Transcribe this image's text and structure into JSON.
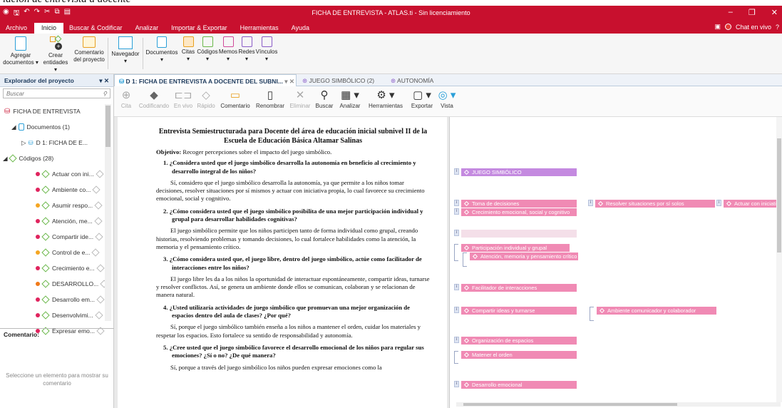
{
  "caption": "lación de entrevista a docente",
  "window": {
    "title": "FICHA DE ENTREVISTA - ATLAS.ti - Sin licenciamiento",
    "controls": [
      "–",
      "❐",
      "✕"
    ]
  },
  "menu": {
    "items": [
      "Archivo",
      "Inicio",
      "Buscar & Codificar",
      "Analizar",
      "Importar & Exportar",
      "Herramientas",
      "Ayuda"
    ],
    "active": "Inicio",
    "chat": "Chat en vivo",
    "help": "?"
  },
  "ribbon": {
    "agregar": [
      "Agregar",
      "documentos ▾"
    ],
    "crear": [
      "Crear",
      "entidades ▾"
    ],
    "comentario": [
      "Comentario",
      "del proyecto"
    ],
    "navegador": "Navegador",
    "documentos": "Documentos",
    "citas": "Citas",
    "codigos": "Códigos",
    "memos": "Memos",
    "redes": "Redes",
    "vinculos": "Vínculos"
  },
  "explorer": {
    "title": "Explorador del proyecto",
    "search_placeholder": "Buscar",
    "project": "FICHA DE ENTREVISTA",
    "documents_group": "Documentos (1)",
    "document": "D 1: FICHA DE E...",
    "codes_group": "Códigos (28)",
    "codes": [
      {
        "label": "Actuar con ini...",
        "color": "#e0245e"
      },
      {
        "label": "Ambiente co...",
        "color": "#e0245e"
      },
      {
        "label": "Asumir respo...",
        "color": "#f5a623"
      },
      {
        "label": "Atención, me...",
        "color": "#e0245e"
      },
      {
        "label": "Compartir ide...",
        "color": "#e0245e"
      },
      {
        "label": "Control de e...",
        "color": "#f5a623"
      },
      {
        "label": "Crecimiento e...",
        "color": "#e0245e"
      },
      {
        "label": "DESARROLLO...",
        "color": "#f07a1a"
      },
      {
        "label": "Desarrollo em...",
        "color": "#e0245e"
      },
      {
        "label": "Desenvolvimi...",
        "color": "#e0245e"
      },
      {
        "label": "Expresar emo...",
        "color": "#e0245e"
      }
    ],
    "comment_label": "Comentario:",
    "comment_placeholder": "Seleccione un elemento para mostrar su comentario"
  },
  "tabs": [
    {
      "label": "D 1: FICHA DE ENTREVISTA A DOCENTE DEL SUBNI...",
      "active": true
    },
    {
      "label": "JUEGO SIMBÓLICO (2)",
      "active": false
    },
    {
      "label": "AUTONOMÍA",
      "active": false
    }
  ],
  "doc_toolbar": {
    "cita": "Cita",
    "codificando": "Codificando",
    "envivo": "En vivo",
    "rapido": "Rápido",
    "comentario": "Comentario",
    "renombrar": "Renombrar",
    "eliminar": "Eliminar",
    "buscar": "Buscar",
    "analizar": "Analizar",
    "herramientas": "Herramientas",
    "exportar": "Exportar",
    "vista": "Vista"
  },
  "document": {
    "title": "Entrevista Semiestructurada para Docente del área de educación inicial subnivel II de la Escuela de Educación Básica Altamar Salinas",
    "objective_label": "Objetivo:",
    "objective_text": " Recoger percepciones sobre el impacto del juego simbólico.",
    "items": [
      {
        "q": "1.  ¿Considera usted que el juego simbólico desarrolla la autonomía en beneficio al crecimiento y desarrollo integral de los niños?",
        "a": "Sí, considero que el juego simbólico desarrolla la autonomía, ya que permite a los niños tomar decisiones, resolver situaciones por sí mismos y actuar con iniciativa propia, lo cual favorece su crecimiento emocional, social y cognitivo."
      },
      {
        "q": "2.  ¿Cómo considera usted que el juego simbólico posibilita de una mejor participación individual y grupal para desarrollar habilidades cognitivas?",
        "a": "El juego simbólico permite que los niños participen tanto de forma individual como grupal, creando historias, resolviendo problemas y tomando decisiones, lo cual fortalece habilidades como la atención, la memoria y el pensamiento crítico."
      },
      {
        "q": "3.  ¿Cómo considera usted que, el juego libre, dentro del juego simbólico, actúe como facilitador de interacciones entre los niños?",
        "a": "El juego libre les da a los niños la oportunidad de interactuar espontáneamente, compartir ideas, turnarse y resolver conflictos. Así, se genera un ambiente donde ellos se comunican, colaboran y se relacionan de manera natural."
      },
      {
        "q": "4.  ¿Usted utilizaría actividades de juego simbólico que promuevan una mejor organización de espacios dentro del aula de clases? ¿Por qué?",
        "a": "Sí, porque el juego simbólico también enseña a los niños a mantener el orden, cuidar los materiales y respetar los espacios. Esto fortalece su sentido de responsabilidad y autonomía."
      },
      {
        "q": "5.  ¿Cree usted que el juego simbólico favorece el desarrollo emocional de los niños para regular sus emociones? ¿Sí o no? ¿De qué manera?",
        "a": "Sí, porque a través del juego simbólico los niños pueden expresar emociones como la"
      }
    ]
  },
  "margin_codes": {
    "juego": "JUEGO SIMBÓLICO",
    "toma": "Toma de decisiones",
    "resolver": "Resolver situaciones por sí solos",
    "actuar": "Actuar con iniciativa",
    "crecimiento": "Crecimiento emocional, social y cognitivo",
    "participacion": "Participación individual y grupal",
    "atencion": "Atención, memoria y pensamiento crítico",
    "facilitador": "Facilitador de interacciones",
    "compartir": "Compartir ideas y turnarse",
    "ambiente": "Ambiente comunicador y colaborador",
    "organizacion": "Organización de espacios",
    "matener": "Matener el orden",
    "desarrollo": "Desarrollo emocional"
  }
}
